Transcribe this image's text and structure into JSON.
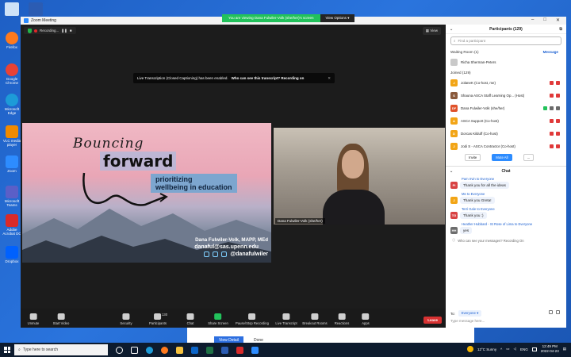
{
  "desktop": {
    "icons": [
      {
        "label": "Google Chrome",
        "color": "#e94235"
      },
      {
        "label": "Microsoft Edge",
        "color": "#1d9bd8"
      },
      {
        "label": "VLC media player",
        "color": "#f08a00"
      },
      {
        "label": "Zoom",
        "color": "#2d8cff"
      },
      {
        "label": "Microsoft Teams",
        "color": "#5b5fc7"
      },
      {
        "label": "Adobe Acrobat DC",
        "color": "#d92a2a"
      },
      {
        "label": "Dropbox",
        "color": "#0061fe"
      }
    ],
    "top_icons": [
      "Recycle Bin",
      "Firefox"
    ]
  },
  "zoom": {
    "window_title": "Zoom Meeting",
    "viewing_banner": "You are viewing Dana Fulwiler-Volk (she/her)'s screen",
    "view_options": "View Options",
    "recording_label": "Recording...",
    "view_button": "View",
    "transcription_banner": {
      "text": "Live Transcription (Closed Captioning) has been enabled.",
      "bold": "Who can see this transcript? Recording on"
    },
    "slide": {
      "title1": "Bouncing",
      "title2": "forward",
      "subtitle_line1": "prioritizing",
      "subtitle_line2": "wellbeing in education",
      "name": "Dana Fulwiler-Volk, MAPP, MEd",
      "email": "danaful@sas.upenn.edu",
      "handle": "@danafulwiler"
    },
    "video_label": "Dana Fulwiler-Volk (she/her)",
    "toolbar": {
      "unmute": "Unmute",
      "start_video": "Start Video",
      "security": "Security",
      "participants": "Participants",
      "participants_count": "130",
      "chat": "Chat",
      "share_screen": "Share Screen",
      "pause_recording": "Pause/Stop Recording",
      "live_transcript": "Live Transcript",
      "breakout": "Breakout Rooms",
      "reactions": "Reactions",
      "apps": "Apps",
      "leave": "Leave"
    }
  },
  "panel": {
    "header": "Participants (129)",
    "find_placeholder": "Find a participant",
    "waiting": "Waiting Room (1)",
    "message_link": "Message",
    "waiting_person": "Richa Sherman-Peters",
    "joined": "Joined (129)",
    "participants": [
      {
        "name": "JolaneK (Co-host, me)",
        "initial": "J",
        "color": "#f2a516"
      },
      {
        "name": "Shauna ASCA Staff Learning Op... (Host)",
        "initial": "S",
        "color": "#8a5a3c"
      },
      {
        "name": "Dana Fulwiler-Volk (she/her)",
        "initial": "DF",
        "color": "#e0522a"
      },
      {
        "name": "ASCA Support (Co-host)",
        "initial": "A",
        "color": "#f2a516"
      },
      {
        "name": "Dorcas Kilduff (Co-host)",
        "initial": "D",
        "color": "#f2a516"
      },
      {
        "name": "Jodi S - ASCA Contractor (Co-host)",
        "initial": "J",
        "color": "#f2a516"
      }
    ],
    "invite": "Invite",
    "mute_all": "Mute All",
    "more": "...",
    "chat_header": "Chat",
    "messages": [
      {
        "from": "Pam Irvin to Everyone",
        "initial": "PI",
        "color": "#d84343",
        "text": "Thank you for all the ideas"
      },
      {
        "from": "Me to Everyone",
        "initial": "J",
        "color": "#f2a516",
        "text": "Thank you Greta!"
      },
      {
        "from": "Terri Gale to Everyone",
        "initial": "TG",
        "color": "#d84343",
        "text": "Thank you :)"
      },
      {
        "from": "Heather Hubbard - St Rose of Lima to Everyone",
        "initial": "HH",
        "color": "#6d6d6d",
        "text": "yes"
      }
    ],
    "notice": "Who can see your messages? Recording On",
    "to_label": "To:",
    "to_value": "Everyone",
    "input_placeholder": "Type message here..."
  },
  "document": {
    "button1": "View Detail",
    "button2": "Done"
  },
  "taskbar": {
    "search_placeholder": "Type here to search",
    "weather": "12°C  Sunny",
    "lang": "ENG",
    "time": "12:49 PM",
    "date": "2022-04-23"
  }
}
